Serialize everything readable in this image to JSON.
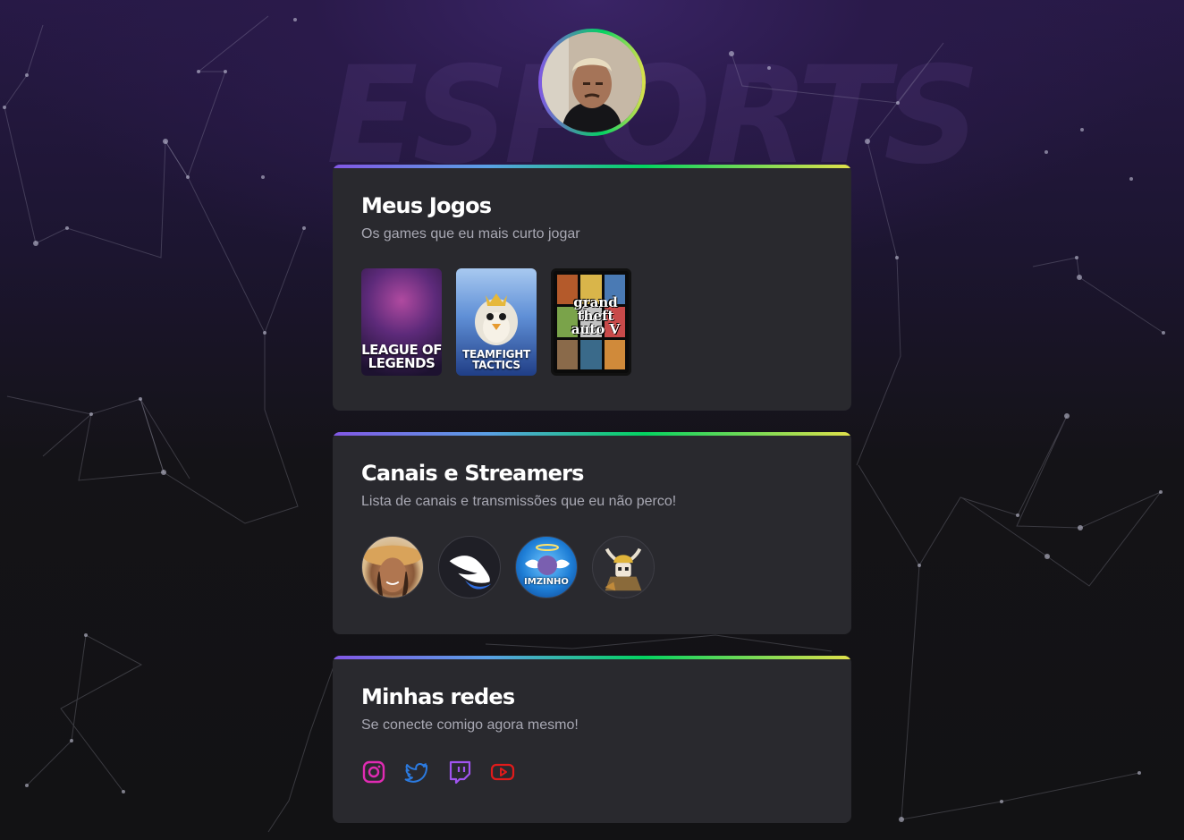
{
  "watermark": {
    "text": "ESPORTS"
  },
  "profile": {
    "avatar_alt": "profile-photo"
  },
  "cards": {
    "games": {
      "title": "Meus Jogos",
      "subtitle": "Os games que eu mais curto jogar",
      "items": [
        {
          "caption": "LEAGUE OF LEGENDS",
          "icon": "league-of-legends-cover"
        },
        {
          "caption": "TEAMFIGHT TACTICS",
          "icon": "teamfight-tactics-cover"
        },
        {
          "caption": "grand theft auto V",
          "icon": "gta-v-cover"
        }
      ]
    },
    "streamers": {
      "title": "Canais e Streamers",
      "subtitle": "Lista de canais e transmissões que eu não perco!",
      "items": [
        {
          "icon": "streamer-avatar-hat"
        },
        {
          "icon": "streamer-avatar-wing"
        },
        {
          "icon": "streamer-avatar-imzinho",
          "label": "IMZINHO"
        },
        {
          "icon": "streamer-avatar-viking"
        }
      ]
    },
    "social": {
      "title": "Minhas redes",
      "subtitle": "Se conecte comigo agora mesmo!",
      "items": [
        {
          "icon": "instagram-icon",
          "color": "#e02bb3"
        },
        {
          "icon": "twitter-icon",
          "color": "#2b7ae0"
        },
        {
          "icon": "twitch-icon",
          "color": "#a054f0"
        },
        {
          "icon": "youtube-icon",
          "color": "#e01b1b"
        }
      ]
    }
  },
  "colors": {
    "background": "#121214",
    "card": "#29292e",
    "accent_gradient": [
      "#8257e5",
      "#04d361",
      "#e1e14b"
    ],
    "subtitle": "#a8a8b3"
  }
}
